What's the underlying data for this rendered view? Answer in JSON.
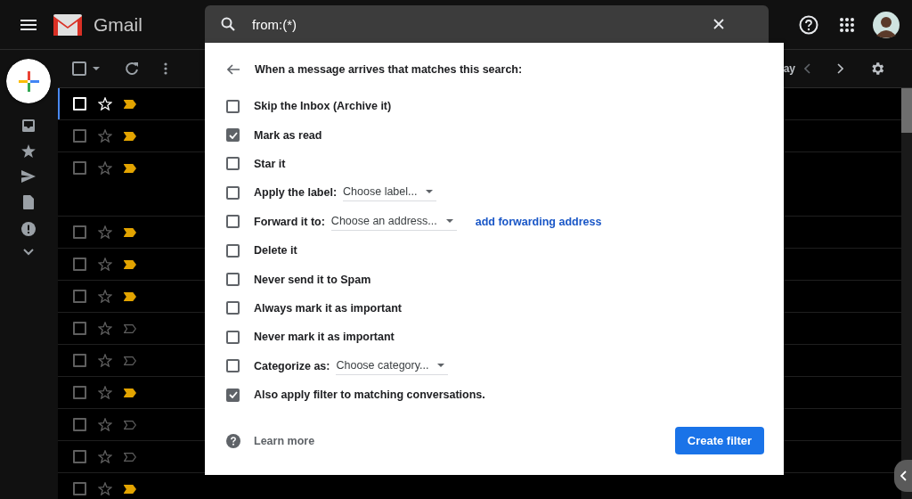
{
  "app": {
    "name": "Gmail"
  },
  "search": {
    "value": "from:(*)"
  },
  "toolbar": {
    "select_all": false,
    "text": "ay"
  },
  "rows": [
    {
      "focused": true,
      "important": true
    },
    {
      "focused": false,
      "important": true
    },
    {
      "focused": false,
      "important": true,
      "tall": true
    },
    {
      "focused": false,
      "important": true
    },
    {
      "focused": false,
      "important": true
    },
    {
      "focused": false,
      "important": true
    },
    {
      "focused": false,
      "important": false
    },
    {
      "focused": false,
      "important": false
    },
    {
      "focused": false,
      "important": true
    },
    {
      "focused": false,
      "important": false
    },
    {
      "focused": false,
      "important": false
    },
    {
      "focused": false,
      "important": true
    }
  ],
  "filter_dialog": {
    "heading": "When a message arrives that matches this search:",
    "options": [
      {
        "kind": "checkbox",
        "label": "Skip the Inbox (Archive it)",
        "checked": false
      },
      {
        "kind": "checkbox",
        "label": "Mark as read",
        "checked": true
      },
      {
        "kind": "checkbox",
        "label": "Star it",
        "checked": false
      },
      {
        "kind": "select",
        "label": "Apply the label:",
        "checked": false,
        "select": "Choose label..."
      },
      {
        "kind": "select",
        "label": "Forward it to:",
        "checked": false,
        "select": "Choose an address...",
        "link": "add forwarding address"
      },
      {
        "kind": "checkbox",
        "label": "Delete it",
        "checked": false
      },
      {
        "kind": "checkbox",
        "label": "Never send it to Spam",
        "checked": false
      },
      {
        "kind": "checkbox",
        "label": "Always mark it as important",
        "checked": false
      },
      {
        "kind": "checkbox",
        "label": "Never mark it as important",
        "checked": false
      },
      {
        "kind": "select",
        "label": "Categorize as:",
        "checked": false,
        "select": "Choose category..."
      },
      {
        "kind": "checkbox",
        "label": "Also apply filter to matching conversations.",
        "checked": true
      }
    ],
    "help_link": "Learn more",
    "submit": "Create filter"
  }
}
